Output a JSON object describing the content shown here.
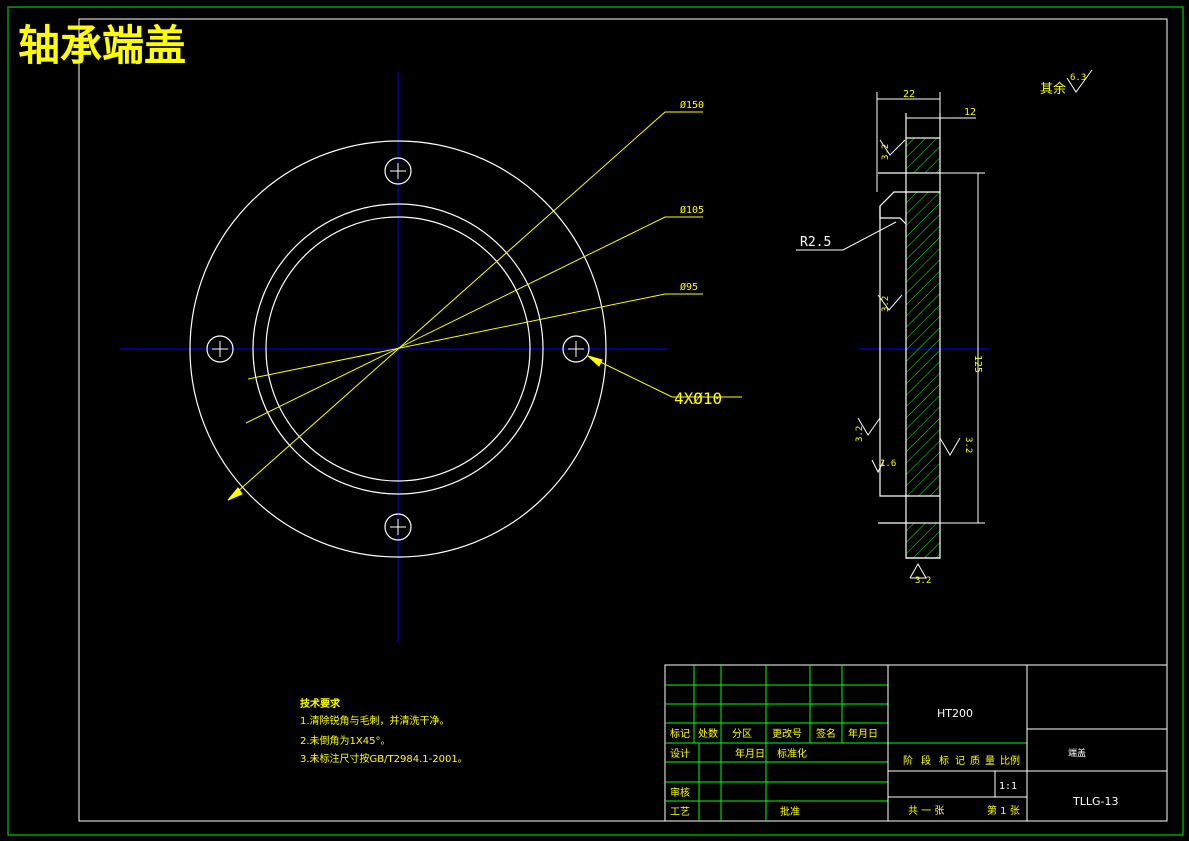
{
  "title": "轴承端盖",
  "roughness": {
    "other_label": "其余",
    "other_value": "6.3",
    "values": [
      "3.2",
      "3.2",
      "3.2",
      "3.2",
      "1.6",
      "3.2"
    ]
  },
  "front_view": {
    "dim_outer": "Ø150",
    "dim_mid": "Ø105",
    "dim_inner": "Ø95",
    "holes": "4XØ10"
  },
  "side_view": {
    "dim_width": "22",
    "dim_step": "12",
    "fillet": "R2.5",
    "dim_pcd": "125"
  },
  "tech": {
    "heading": "技术要求",
    "lines": [
      "1.清除锐角与毛刺，并清洗干净。",
      "2.未倒角为1X45°。",
      "3.未标注尺寸按GB/T2984.1-2001。"
    ]
  },
  "title_block": {
    "material": "HT200",
    "rev_headers": [
      "标记",
      "处数",
      "分区",
      "更改号",
      "签名",
      "年月日"
    ],
    "design": "设计",
    "date": "年月日",
    "standard": "标准化",
    "review": "审核",
    "process": "工艺",
    "approve": "批准",
    "stage_headers": [
      "阶",
      "段",
      "标",
      "记",
      "质",
      "量",
      "比例"
    ],
    "scale": "1:1",
    "total_sheets": "共 一 张",
    "sheet_no": "第 1 张",
    "drawing_name": "端盖",
    "drawing_no": "TLLG-13"
  },
  "colors": {
    "border_green": "#00c800",
    "title_yellow": "#ffff00",
    "line_white": "#ffffff",
    "centerline_blue": "#0000ff",
    "hatch_green": "#00ff00"
  }
}
